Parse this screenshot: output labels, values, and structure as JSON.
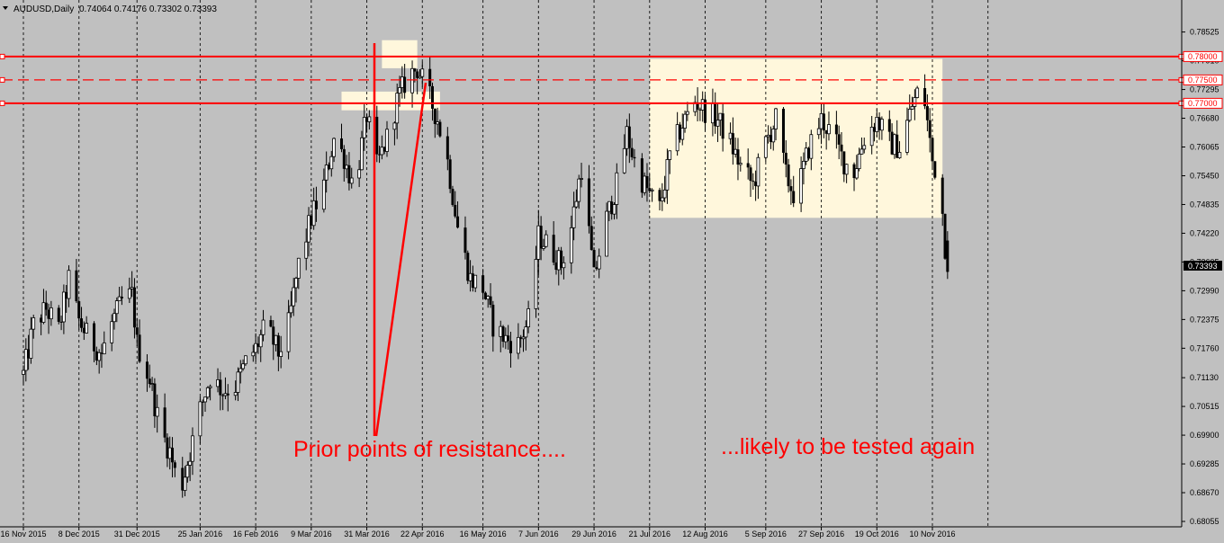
{
  "header": {
    "symbol": "AUDUSD,Daily",
    "ohlc": "0.74064 0.74176 0.73302 0.73393"
  },
  "annotations": {
    "left": "Prior points of resistance....",
    "right": "...likely to be tested again"
  },
  "colors": {
    "background": "#c0c0c0",
    "candle": "#000000",
    "resistance": "#ff0000",
    "zone": "#fff7dc",
    "grid": "#000000"
  },
  "chart_data": {
    "type": "candlestick",
    "symbol": "AUDUSD",
    "timeframe": "Daily",
    "ylim": [
      0.68055,
      0.78825
    ],
    "y_ticks": [
      "0.78525",
      "0.77910",
      "0.77295",
      "0.76680",
      "0.76065",
      "0.75450",
      "0.74835",
      "0.74220",
      "0.73605",
      "0.72990",
      "0.72375",
      "0.71760",
      "0.71130",
      "0.70515",
      "0.69900",
      "0.69285",
      "0.68670",
      "0.68055"
    ],
    "x_ticks": [
      "16 Nov 2015",
      "8 Dec 2015",
      "31 Dec 2015",
      "25 Jan 2016",
      "16 Feb 2016",
      "9 Mar 2016",
      "31 Mar 2016",
      "22 Apr 2016",
      "16 May 2016",
      "7 Jun 2016",
      "29 Jun 2016",
      "21 Jul 2016",
      "12 Aug 2016",
      "5 Sep 2016",
      "27 Sep 2016",
      "19 Oct 2016",
      "10 Nov 2016"
    ],
    "last_price": "0.73393",
    "grid": "vertical dotted",
    "resistance_levels": [
      {
        "label": "0.78000",
        "value": 0.78,
        "style": "solid"
      },
      {
        "label": "0.77500",
        "value": 0.775,
        "style": "dashed"
      },
      {
        "label": "0.77000",
        "value": 0.77,
        "style": "solid"
      }
    ],
    "zones": [
      {
        "from": "6 Apr 2016",
        "to": "20 Apr 2016",
        "low": 0.7775,
        "high": 0.7835
      },
      {
        "from": "21 Mar 2016",
        "to": "29 Apr 2016",
        "low": 0.7685,
        "high": 0.7725
      },
      {
        "from": "21 Jul 2016",
        "to": "14 Nov 2016",
        "low": 0.7455,
        "high": 0.7795
      }
    ],
    "close_path": [
      [
        "16 Nov 2015",
        0.712
      ],
      [
        "20 Nov 2015",
        0.7225
      ],
      [
        "25 Nov 2015",
        0.726
      ],
      [
        "30 Nov 2015",
        0.7215
      ],
      [
        "4 Dec 2015",
        0.7325
      ],
      [
        "8 Dec 2015",
        0.7235
      ],
      [
        "12 Dec 2015",
        0.7195
      ],
      [
        "17 Dec 2015",
        0.7165
      ],
      [
        "21 Dec 2015",
        0.723
      ],
      [
        "25 Dec 2015",
        0.7275
      ],
      [
        "29 Dec 2015",
        0.729
      ],
      [
        "31 Dec 2015",
        0.7185
      ],
      [
        "5 Jan 2016",
        0.711
      ],
      [
        "9 Jan 2016",
        0.7005
      ],
      [
        "13 Jan 2016",
        0.6955
      ],
      [
        "17 Jan 2016",
        0.6865
      ],
      [
        "21 Jan 2016",
        0.6955
      ],
      [
        "25 Jan 2016",
        0.7045
      ],
      [
        "29 Jan 2016",
        0.7115
      ],
      [
        "3 Feb 2016",
        0.7085
      ],
      [
        "8 Feb 2016",
        0.7095
      ],
      [
        "12 Feb 2016",
        0.7145
      ],
      [
        "16 Feb 2016",
        0.7175
      ],
      [
        "20 Feb 2016",
        0.7225
      ],
      [
        "25 Feb 2016",
        0.7165
      ],
      [
        "29 Feb 2016",
        0.7225
      ],
      [
        "4 Mar 2016",
        0.7355
      ],
      [
        "9 Mar 2016",
        0.7455
      ],
      [
        "14 Mar 2016",
        0.7525
      ],
      [
        "18 Mar 2016",
        0.7625
      ],
      [
        "22 Mar 2016",
        0.7585
      ],
      [
        "26 Mar 2016",
        0.7515
      ],
      [
        "31 Mar 2016",
        0.7675
      ],
      [
        "4 Apr 2016",
        0.7565
      ],
      [
        "8 Apr 2016",
        0.7625
      ],
      [
        "12 Apr 2016",
        0.7705
      ],
      [
        "16 Apr 2016",
        0.7755
      ],
      [
        "20 Apr 2016",
        0.7775
      ],
      [
        "24 Apr 2016",
        0.7725
      ],
      [
        "28 Apr 2016",
        0.7665
      ],
      [
        "2 May 2016",
        0.7575
      ],
      [
        "6 May 2016",
        0.7435
      ],
      [
        "11 May 2016",
        0.7325
      ],
      [
        "16 May 2016",
        0.7305
      ],
      [
        "20 May 2016",
        0.7225
      ],
      [
        "25 May 2016",
        0.7195
      ],
      [
        "30 May 2016",
        0.7185
      ],
      [
        "3 Jun 2016",
        0.7235
      ],
      [
        "7 Jun 2016",
        0.7415
      ],
      [
        "11 Jun 2016",
        0.7395
      ],
      [
        "16 Jun 2016",
        0.7355
      ],
      [
        "20 Jun 2016",
        0.7435
      ],
      [
        "24 Jun 2016",
        0.7565
      ],
      [
        "29 Jun 2016",
        0.7325
      ],
      [
        "3 Jul 2016",
        0.7435
      ],
      [
        "8 Jul 2016",
        0.7525
      ],
      [
        "12 Jul 2016",
        0.7635
      ],
      [
        "16 Jul 2016",
        0.7555
      ],
      [
        "21 Jul 2016",
        0.7505
      ],
      [
        "25 Jul 2016",
        0.7475
      ],
      [
        "29 Jul 2016",
        0.7585
      ],
      [
        "3 Aug 2016",
        0.7655
      ],
      [
        "8 Aug 2016",
        0.7705
      ],
      [
        "12 Aug 2016",
        0.7685
      ],
      [
        "17 Aug 2016",
        0.7665
      ],
      [
        "22 Aug 2016",
        0.7615
      ],
      [
        "26 Aug 2016",
        0.7565
      ],
      [
        "31 Aug 2016",
        0.7525
      ],
      [
        "5 Sep 2016",
        0.7615
      ],
      [
        "9 Sep 2016",
        0.7665
      ],
      [
        "13 Sep 2016",
        0.7545
      ],
      [
        "17 Sep 2016",
        0.7495
      ],
      [
        "22 Sep 2016",
        0.7605
      ],
      [
        "27 Sep 2016",
        0.7665
      ],
      [
        "1 Oct 2016",
        0.7635
      ],
      [
        "6 Oct 2016",
        0.7575
      ],
      [
        "10 Oct 2016",
        0.7555
      ],
      [
        "14 Oct 2016",
        0.7625
      ],
      [
        "19 Oct 2016",
        0.7665
      ],
      [
        "24 Oct 2016",
        0.7615
      ],
      [
        "28 Oct 2016",
        0.7605
      ],
      [
        "2 Nov 2016",
        0.7695
      ],
      [
        "6 Nov 2016",
        0.7745
      ],
      [
        "10 Nov 2016",
        0.7575
      ],
      [
        "13 Nov 2016",
        0.7535
      ],
      [
        "15 Nov 2016",
        0.7395
      ],
      [
        "16 Nov 2016",
        0.7339
      ]
    ]
  }
}
